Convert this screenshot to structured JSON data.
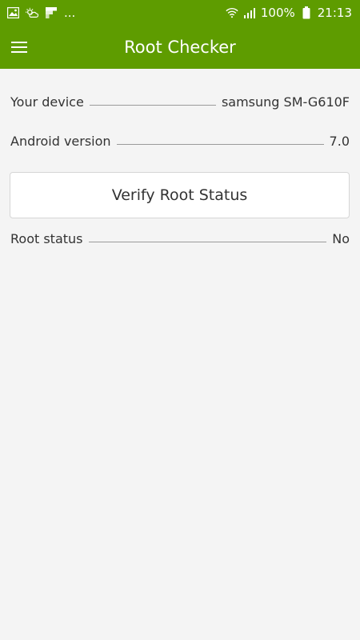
{
  "status_bar": {
    "left_icons": [
      "image-icon",
      "weather-icon",
      "flipboard-icon"
    ],
    "overflow": "...",
    "battery_percent": "100%",
    "time": "21:13"
  },
  "toolbar": {
    "title": "Root Checker",
    "menu_icon": "hamburger-menu-icon"
  },
  "info": {
    "device_label": "Your device",
    "device_value": "samsung SM-G610F",
    "android_label": "Android version",
    "android_value": "7.0"
  },
  "verify_button": {
    "label": "Verify Root Status"
  },
  "root_status": {
    "label": "Root status",
    "value": "No"
  },
  "colors": {
    "accent": "#5e9c00",
    "background": "#f4f4f4",
    "text": "#333333"
  }
}
